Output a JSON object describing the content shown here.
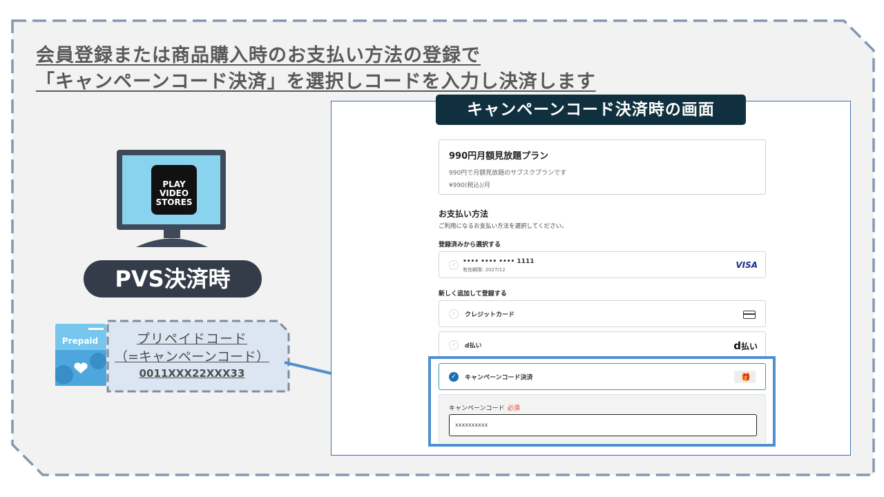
{
  "heading": {
    "line1": "会員登録または商品購入時のお支払い方法の登録で",
    "line2": "「キャンペーンコード決済」を選択しコードを入力し決済します"
  },
  "left": {
    "monitor_logo": [
      "PLAY",
      "VIDEO",
      "STORES"
    ],
    "pvs_label": "PVS決済時",
    "prepaid_card_label": "Prepaid",
    "prepaid_title": "プリペイドコード",
    "prepaid_subtitle": "（=キャンペーンコード）",
    "prepaid_code": "0011XXX22XXX33"
  },
  "panel": {
    "title": "キャンペーンコード決済時の画面",
    "plan": {
      "name": "990円月額見放題プラン",
      "description": "990円で月額見放題のサブスクプランです",
      "price": "¥990(税込)/月"
    },
    "payment": {
      "title": "お支払い方法",
      "subtitle": "ご利用になるお支払い方法を選択してください。",
      "registered_label": "登録済みから選択する",
      "saved_card": {
        "number": "•••• •••• •••• 1111",
        "expiry": "有効期限: 2027/12",
        "brand": "VISA"
      },
      "new_label": "新しく追加して登録する",
      "options": {
        "credit": "クレジットカード",
        "dpay": "d払い",
        "dpay_logo_d": "d",
        "dpay_logo_text": "払い",
        "campaign": "キャンペーンコード決済"
      },
      "campaign_code": {
        "label": "キャンペーンコード",
        "required": "必須",
        "value": "xxxxxxxxxx"
      }
    }
  },
  "colors": {
    "panel_title_bg": "#10303f",
    "highlight": "#4f8fcf",
    "arrow": "#4f8fcf",
    "pill_bg": "#343c4a",
    "required": "#e03c2a"
  }
}
